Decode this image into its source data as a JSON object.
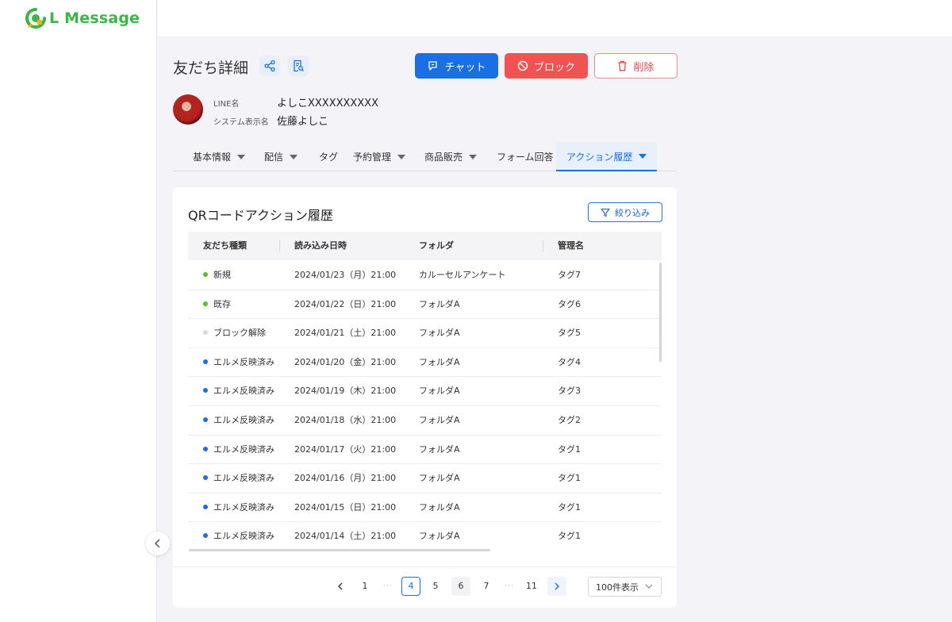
{
  "app": {
    "logo_text": "L Message"
  },
  "header": {
    "title": "友だち詳細",
    "buttons": {
      "chat": "チャット",
      "block": "ブロック",
      "delete": "削除"
    }
  },
  "profile": {
    "line_name_label": "LINE名",
    "line_name": "よしこXXXXXXXXXX",
    "system_name_label": "システム表示名",
    "system_name": "佐藤よしこ"
  },
  "tabs": [
    {
      "label": "基本情報",
      "dropdown": true
    },
    {
      "label": "配信",
      "dropdown": true
    },
    {
      "label": "タグ",
      "dropdown": false
    },
    {
      "label": "予約管理",
      "dropdown": true
    },
    {
      "label": "商品販売",
      "dropdown": true
    },
    {
      "label": "フォーム回答",
      "dropdown": false
    },
    {
      "label": "アクション履歴",
      "dropdown": true,
      "active": true
    }
  ],
  "panel": {
    "title": "QRコードアクション履歴",
    "filter_label": "絞り込み",
    "columns": [
      "友だち種類",
      "読み込み日時",
      "フォルダ",
      "管理名"
    ],
    "rows": [
      {
        "type": "新規",
        "status_color": "#52c41a",
        "datetime": "2024/01/23（月）21:00",
        "folder": "カルーセルアンケート",
        "tag": "タグ7"
      },
      {
        "type": "既存",
        "status_color": "#52c41a",
        "datetime": "2024/01/22（日）21:00",
        "folder": "フォルダA",
        "tag": "タグ6"
      },
      {
        "type": "ブロック解除",
        "status_color": "#d9d9e0",
        "datetime": "2024/01/21（土）21:00",
        "folder": "フォルダA",
        "tag": "タグ5"
      },
      {
        "type": "エルメ反映済み",
        "status_color": "#1b6fe4",
        "datetime": "2024/01/20（金）21:00",
        "folder": "フォルダA",
        "tag": "タグ4"
      },
      {
        "type": "エルメ反映済み",
        "status_color": "#1b6fe4",
        "datetime": "2024/01/19（木）21:00",
        "folder": "フォルダA",
        "tag": "タグ3"
      },
      {
        "type": "エルメ反映済み",
        "status_color": "#1b6fe4",
        "datetime": "2024/01/18（水）21:00",
        "folder": "フォルダA",
        "tag": "タグ2"
      },
      {
        "type": "エルメ反映済み",
        "status_color": "#1b6fe4",
        "datetime": "2024/01/17（火）21:00",
        "folder": "フォルダA",
        "tag": "タグ1"
      },
      {
        "type": "エルメ反映済み",
        "status_color": "#1b6fe4",
        "datetime": "2024/01/16（月）21:00",
        "folder": "フォルダA",
        "tag": "タグ1"
      },
      {
        "type": "エルメ反映済み",
        "status_color": "#1b6fe4",
        "datetime": "2024/01/15（日）21:00",
        "folder": "フォルダA",
        "tag": "タグ1"
      },
      {
        "type": "エルメ反映済み",
        "status_color": "#1b6fe4",
        "datetime": "2024/01/14（土）21:00",
        "folder": "フォルダA",
        "tag": "タグ1"
      }
    ]
  },
  "pagination": {
    "pages": [
      "1",
      "···",
      "4",
      "5",
      "6",
      "7",
      "···",
      "11"
    ],
    "current": "4",
    "per_page": "100件表示"
  },
  "colors": {
    "primary": "#1b6fe4",
    "danger": "#f15353",
    "brand": "#3bb44a"
  }
}
